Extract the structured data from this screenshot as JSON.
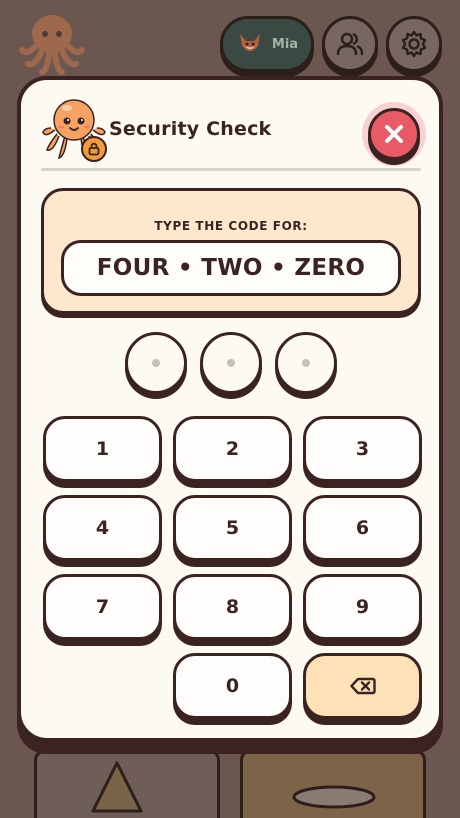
{
  "header": {
    "profile_name": "Mia",
    "icons": [
      "octopus-logo-icon",
      "fox-avatar-icon",
      "users-icon",
      "gear-icon"
    ]
  },
  "modal": {
    "title": "Security Check",
    "mascot_icon": "octopus-mascot-icon",
    "badge_icon": "lock-icon",
    "close_icon": "close-icon",
    "instruction": "TYPE THE CODE FOR:",
    "code_words": "FOUR • TWO • ZERO",
    "pin_slots": [
      "",
      "",
      ""
    ],
    "keypad": {
      "k1": "1",
      "k2": "2",
      "k3": "3",
      "k4": "4",
      "k5": "5",
      "k6": "6",
      "k7": "7",
      "k8": "8",
      "k9": "9",
      "k0": "0",
      "backspace_icon": "backspace-icon"
    }
  },
  "colors": {
    "accent_close": "#e85a66",
    "panel": "#fde7cd",
    "backspace_key": "#fde2b8",
    "outline": "#3b2321",
    "profile_pill": "#3a4a43"
  }
}
